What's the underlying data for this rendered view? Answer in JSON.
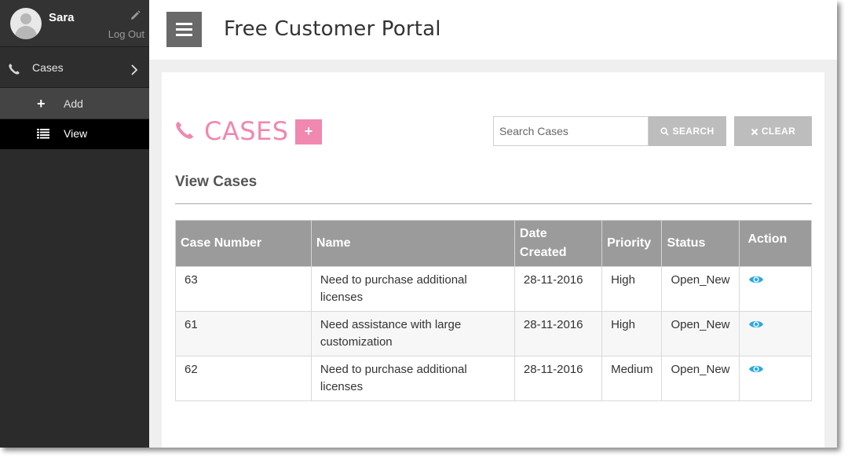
{
  "sidebar": {
    "user_name": "Sara",
    "logout_label": "Log Out",
    "nav": {
      "cases_label": "Cases",
      "add_label": "Add",
      "view_label": "View"
    }
  },
  "header": {
    "title": "Free Customer Portal"
  },
  "main": {
    "heading": "CASES",
    "add_button_label": "+",
    "search_placeholder": "Search Cases",
    "search_value": "",
    "search_button_label": "SEARCH",
    "clear_button_label": "CLEAR",
    "subheading": "View Cases",
    "columns": [
      "Case Number",
      "Name",
      "Date Created",
      "Priority",
      "Status",
      "Action"
    ],
    "rows": [
      {
        "case_number": "63",
        "name": "Need to purchase additional licenses",
        "date_created": "28-11-2016",
        "priority": "High",
        "status": "Open_New"
      },
      {
        "case_number": "61",
        "name": "Need assistance with large customization",
        "date_created": "28-11-2016",
        "priority": "High",
        "status": "Open_New"
      },
      {
        "case_number": "62",
        "name": "Need to purchase additional licenses",
        "date_created": "28-11-2016",
        "priority": "Medium",
        "status": "Open_New"
      }
    ]
  },
  "colors": {
    "accent_pink": "#f088b0",
    "sidebar_bg": "#2b2b2b",
    "table_header_bg": "#9b9b9b",
    "eye_icon": "#29a8e0"
  },
  "icons": {
    "edit": "pencil-icon",
    "nav_cases": "phone-icon",
    "nav_add": "plus-icon",
    "nav_view": "list-icon",
    "menu": "hamburger-icon",
    "search": "search-icon",
    "clear": "close-icon",
    "action": "eye-icon"
  }
}
